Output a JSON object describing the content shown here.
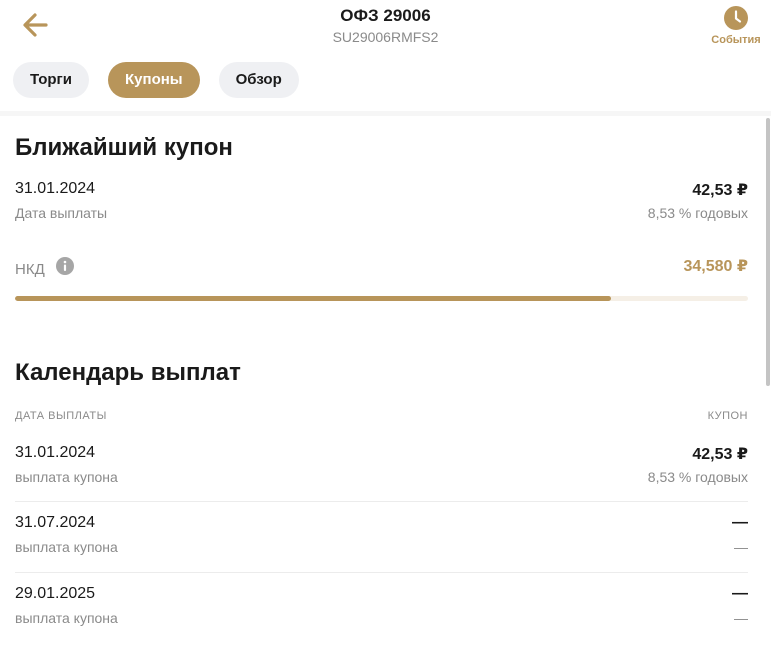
{
  "header": {
    "title": "ОФЗ 29006",
    "subtitle": "SU29006RMFS2",
    "back_icon": "arrow-left-icon",
    "events_label": "События",
    "events_icon": "clock-icon"
  },
  "tabs": [
    {
      "label": "Торги",
      "active": false
    },
    {
      "label": "Купоны",
      "active": true
    },
    {
      "label": "Обзор",
      "active": false
    }
  ],
  "nearest_coupon": {
    "title": "Ближайший купон",
    "date": "31.01.2024",
    "date_label": "Дата выплаты",
    "amount": "42,53 ₽",
    "rate": "8,53 % годовых",
    "nkd_label": "НКД",
    "nkd_icon": "info-icon",
    "nkd_value": "34,580 ₽",
    "nkd_progress": 0.813
  },
  "calendar": {
    "title": "Календарь выплат",
    "col_date": "ДАТА ВЫПЛАТЫ",
    "col_coupon": "КУПОН",
    "rows": [
      {
        "date": "31.01.2024",
        "type": "выплата купона",
        "amount": "42,53 ₽",
        "rate": "8,53 % годовых"
      },
      {
        "date": "31.07.2024",
        "type": "выплата купона",
        "amount": "—",
        "rate": "—"
      },
      {
        "date": "29.01.2025",
        "type": "выплата купона",
        "amount": "—",
        "rate": "—"
      }
    ]
  },
  "colors": {
    "accent": "#b8955a",
    "muted_text": "#8a8a8a",
    "tab_bg": "#eff0f3"
  }
}
